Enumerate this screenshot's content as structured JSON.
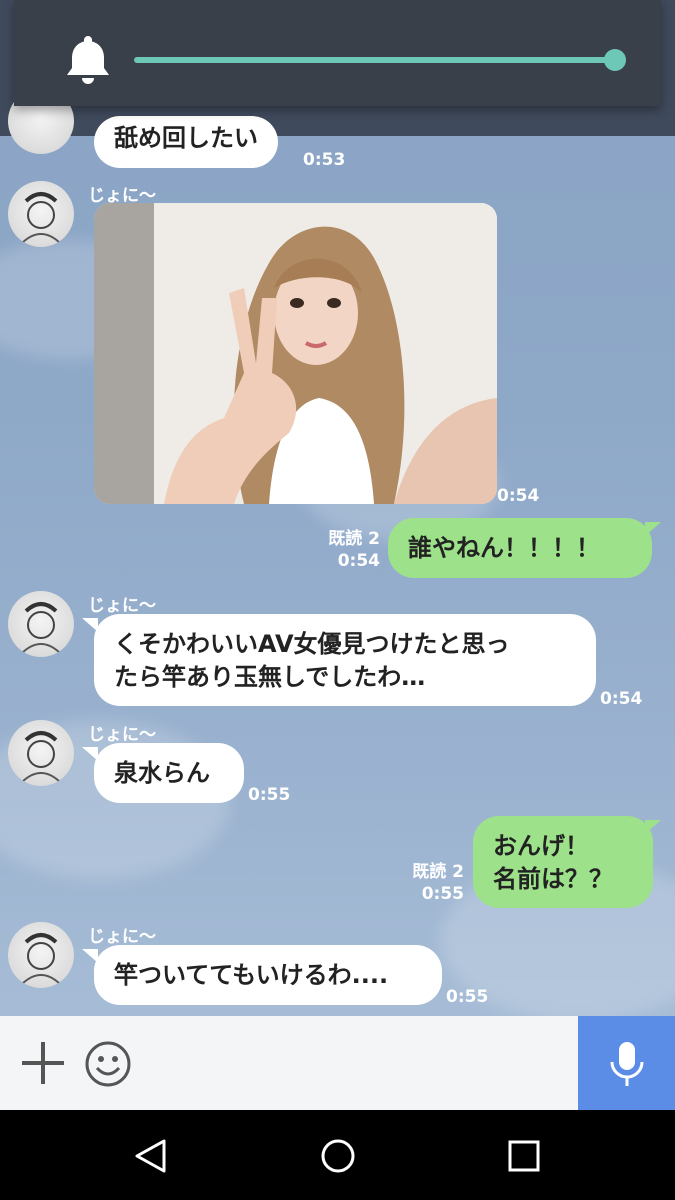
{
  "volume": {
    "level": 1.0,
    "accent_color": "#6ec8b8",
    "icon": "bell-icon"
  },
  "messages": [
    {
      "side": "left",
      "text": "舐め回したい",
      "time": "0:53"
    },
    {
      "side": "left",
      "sender": "じょに〜",
      "type": "image",
      "time": "0:54"
    },
    {
      "side": "right",
      "text": "誰やねん！！！！",
      "read": "既読 2",
      "time": "0:54"
    },
    {
      "side": "left",
      "sender": "じょに〜",
      "text_line1": "くそかわいいAV女優見つけたと思っ",
      "text_line2": "たら竿あり玉無しでしたわ…",
      "time": "0:54"
    },
    {
      "side": "left",
      "sender": "じょに〜",
      "text": "泉水らん",
      "time": "0:55"
    },
    {
      "side": "right",
      "text_line1": "おんげ！",
      "text_line2": "名前は？？",
      "read": "既読 2",
      "time": "0:55"
    },
    {
      "side": "left",
      "sender": "じょに〜",
      "text": "竿ついててもいけるわ....",
      "time": "0:55"
    }
  ],
  "input_bar": {
    "plus_icon": "plus-icon",
    "emoji_icon": "emoji-icon",
    "mic_icon": "mic-icon",
    "mic_color": "#5b8ce6"
  },
  "nav": {
    "back_icon": "back-icon",
    "home_icon": "home-icon",
    "recents_icon": "recents-icon"
  },
  "colors": {
    "chat_bg": "#8ea8c8",
    "sent_bubble": "#9de28a",
    "received_bubble": "#ffffff"
  }
}
